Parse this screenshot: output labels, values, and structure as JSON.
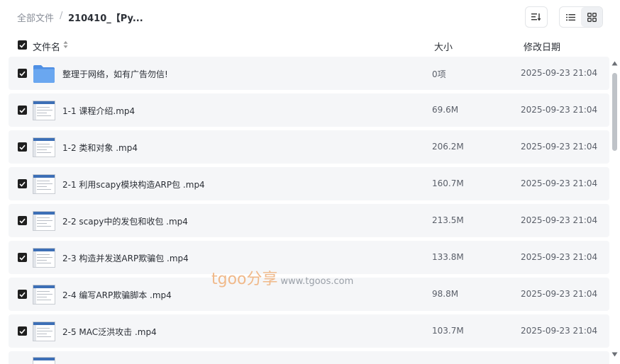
{
  "breadcrumb": {
    "root": "全部文件",
    "separator": "/",
    "current": "210410_【Py..."
  },
  "toolbar": {
    "sort_icon": "sort-icon",
    "list_view_icon": "list-view-icon",
    "grid_view_icon": "grid-view-icon"
  },
  "columns": {
    "name": "文件名",
    "size": "大小",
    "date": "修改日期"
  },
  "files": [
    {
      "type": "folder",
      "name": "整理于网络，如有广告勿信!",
      "size": "0项",
      "date": "2025-09-23 21:04"
    },
    {
      "type": "video",
      "name": "1-1 课程介绍.mp4",
      "size": "69.6M",
      "date": "2025-09-23 21:04"
    },
    {
      "type": "video",
      "name": "1-2 类和对象 .mp4",
      "size": "206.2M",
      "date": "2025-09-23 21:04"
    },
    {
      "type": "video",
      "name": "2-1 利用scapy模块构造ARP包 .mp4",
      "size": "160.7M",
      "date": "2025-09-23 21:04"
    },
    {
      "type": "video",
      "name": "2-2 scapy中的发包和收包 .mp4",
      "size": "213.5M",
      "date": "2025-09-23 21:04"
    },
    {
      "type": "video",
      "name": "2-3 构造并发送ARP欺骗包 .mp4",
      "size": "133.8M",
      "date": "2025-09-23 21:04"
    },
    {
      "type": "video",
      "name": "2-4 编写ARP欺骗脚本 .mp4",
      "size": "98.8M",
      "date": "2025-09-23 21:04"
    },
    {
      "type": "video",
      "name": "2-5 MAC泛洪攻击 .mp4",
      "size": "103.7M",
      "date": "2025-09-23 21:04"
    }
  ],
  "watermark": {
    "brand": "tgoo分享",
    "url": "www.tgoos.com"
  },
  "colors": {
    "row_bg": "#f5f6f8",
    "checkbox": "#1f1f1f",
    "folder": "#5b9bea",
    "watermark": "#f0b98a"
  }
}
